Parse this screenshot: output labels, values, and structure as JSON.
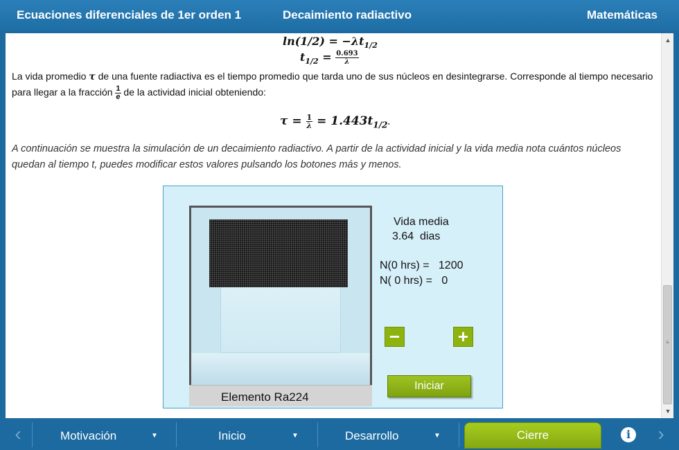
{
  "header": {
    "course": "Ecuaciones diferenciales de 1er orden 1",
    "topic": "Decaimiento radiactivo",
    "subject": "Matemáticas"
  },
  "content": {
    "eq1": "ln(1/2) = −λt",
    "eq1_sub": "1/2",
    "eq2_lhs": "t",
    "eq2_sub": "1/2",
    "eq2_eq": " = ",
    "eq2_num": "0.693",
    "eq2_den": "λ",
    "para1_a": "La vida promedio ",
    "para1_tau": "τ",
    "para1_b": " de una fuente radiactiva es el tiempo promedio que tarda uno de sus núcleos en desintegrarse. Corresponde al tiempo necesario para llegar a la fracción ",
    "para1_frac_num": "1",
    "para1_frac_den": "e",
    "para1_c": " de la actividad inicial obteniendo:",
    "eq3_lhs": "τ = ",
    "eq3_num": "1",
    "eq3_den": "λ",
    "eq3_rhs": " = 1.443t",
    "eq3_sub": "1/2",
    "eq3_end": ".",
    "para2": "  A continuación se muestra la simulación de un decaimiento radiactivo. A partir de la actividad inicial y la vida media nota cuántos núcleos quedan al tiempo t, puedes modificar estos valores pulsando los botones más y menos."
  },
  "simulation": {
    "element_label": "Elemento Ra224",
    "half_life_label": "Vida media",
    "half_life_value": "3.64  dias",
    "n0_line": "N(0 hrs) =   1200",
    "nt_line": "N( 0 hrs) =   0",
    "minus_label": "−",
    "plus_label": "+",
    "start_label": "Iniciar"
  },
  "footer": {
    "nav": [
      {
        "label": "Motivación"
      },
      {
        "label": "Inicio"
      },
      {
        "label": "Desarrollo"
      }
    ],
    "active": "Cierre",
    "info_glyph": "i",
    "prev_glyph": "‹",
    "next_glyph": "›"
  },
  "colors": {
    "header_blue": "#1f6ea6",
    "accent_green": "#8db40e"
  }
}
